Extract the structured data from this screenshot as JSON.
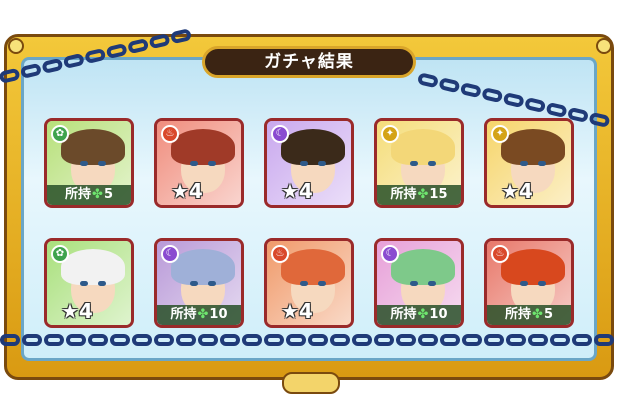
{
  "title": "ガチャ結果",
  "results": [
    {
      "element": "wood",
      "element_color": "#3fa34d",
      "bg": "#b7e07a",
      "hair": "#6b4a2a",
      "display": "owned",
      "owned_label": "所持",
      "owned_count": "5"
    },
    {
      "element": "fire",
      "element_color": "#d9482b",
      "bg": "#f08d7d",
      "hair": "#a03a28",
      "display": "stars",
      "stars": "★4"
    },
    {
      "element": "dark",
      "element_color": "#8a4bd0",
      "bg": "#c9a8ee",
      "hair": "#3b2a1a",
      "display": "stars",
      "stars": "★4"
    },
    {
      "element": "light",
      "element_color": "#d4a317",
      "bg": "#f5dd7a",
      "hair": "#f3d778",
      "display": "owned",
      "owned_label": "所持",
      "owned_count": "15"
    },
    {
      "element": "light",
      "element_color": "#d4a317",
      "bg": "#f6d56a",
      "hair": "#7a4a22",
      "display": "stars",
      "stars": "★4"
    },
    {
      "element": "wood",
      "element_color": "#3fa34d",
      "bg": "#a9e07c",
      "hair": "#f2f2f2",
      "display": "stars",
      "stars": "★4"
    },
    {
      "element": "dark",
      "element_color": "#8a4bd0",
      "bg": "#b99ad8",
      "hair": "#9fb0d8",
      "display": "owned",
      "owned_label": "所持",
      "owned_count": "10"
    },
    {
      "element": "fire",
      "element_color": "#d9482b",
      "bg": "#f09a6a",
      "hair": "#e0683a",
      "display": "stars",
      "stars": "★4"
    },
    {
      "element": "dark",
      "element_color": "#8a4bd0",
      "bg": "#e7a0d8",
      "hair": "#7ec98a",
      "display": "owned",
      "owned_label": "所持",
      "owned_count": "10"
    },
    {
      "element": "fire",
      "element_color": "#d9482b",
      "bg": "#e8786a",
      "hair": "#d8481e",
      "display": "owned",
      "owned_label": "所持",
      "owned_count": "5"
    }
  ]
}
